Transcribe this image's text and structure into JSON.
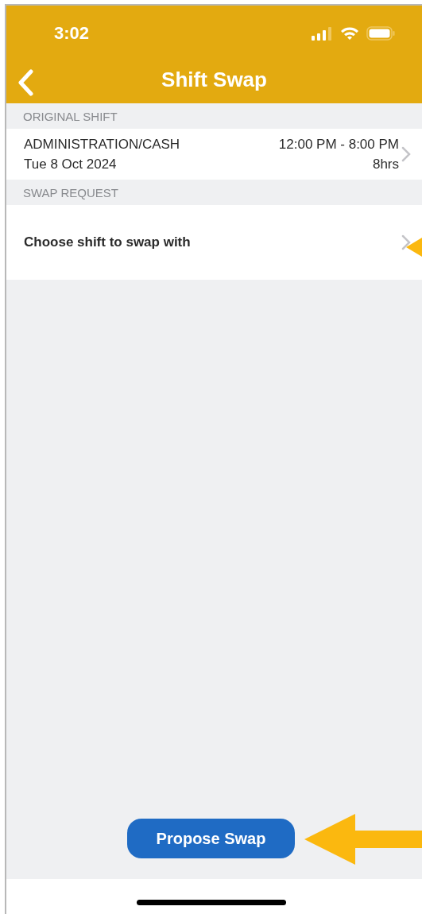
{
  "status_bar": {
    "time": "3:02"
  },
  "nav": {
    "title": "Shift Swap"
  },
  "sections": [
    {
      "header": "ORIGINAL SHIFT",
      "kind": "shift",
      "title": "ADMINISTRATION/CASH",
      "subtitle": "Tue 8 Oct 2024",
      "time": "12:00 PM - 8:00 PM",
      "duration": "8hrs"
    },
    {
      "header": "SWAP REQUEST",
      "kind": "choose",
      "title": "Choose shift to swap with"
    }
  ],
  "button": {
    "label": "Propose Swap"
  }
}
